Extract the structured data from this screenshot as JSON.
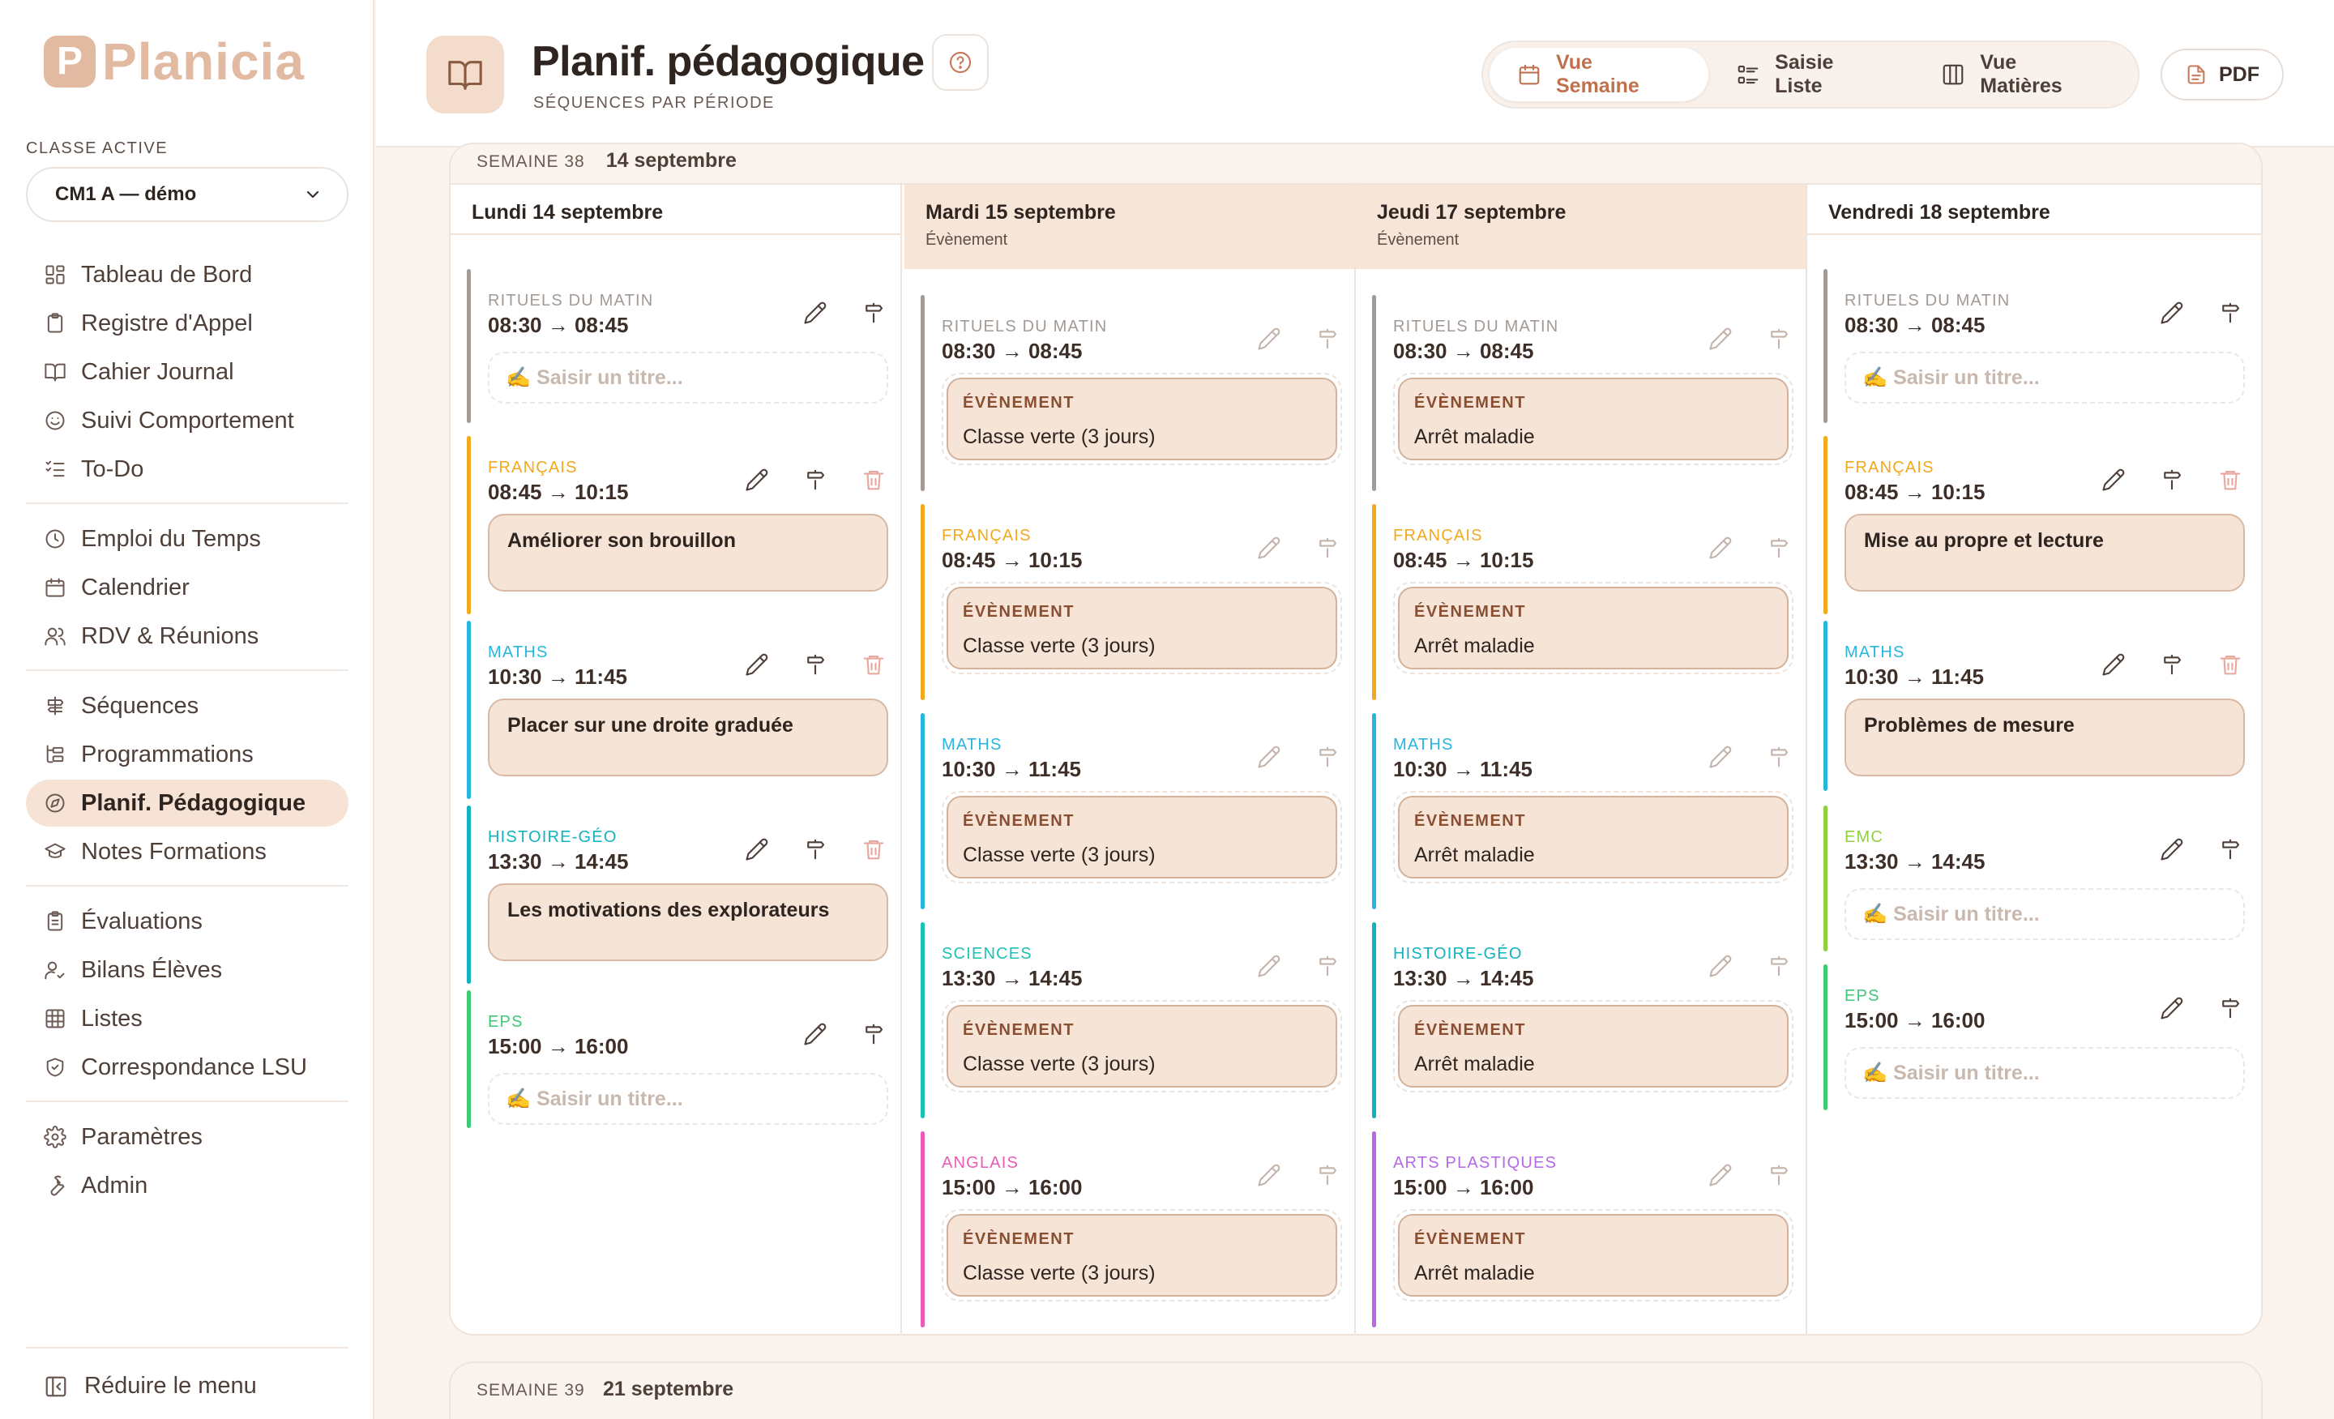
{
  "app": {
    "logo_letter": "P",
    "name": "Planicia"
  },
  "sidebar": {
    "class_caption": "CLASSE ACTIVE",
    "class_value": "CM1 A — démo",
    "groups": [
      [
        {
          "label": "Tableau de Bord",
          "icon": "dashboard-icon"
        },
        {
          "label": "Registre d'Appel",
          "icon": "clipboard-icon"
        },
        {
          "label": "Cahier Journal",
          "icon": "book-open-icon"
        },
        {
          "label": "Suivi Comportement",
          "icon": "smile-icon"
        },
        {
          "label": "To-Do",
          "icon": "checklist-icon"
        }
      ],
      [
        {
          "label": "Emploi du Temps",
          "icon": "clock-icon"
        },
        {
          "label": "Calendrier",
          "icon": "calendar-icon"
        },
        {
          "label": "RDV & Réunions",
          "icon": "users-icon"
        }
      ],
      [
        {
          "label": "Séquences",
          "icon": "signpost-icon"
        },
        {
          "label": "Programmations",
          "icon": "tree-icon"
        },
        {
          "label": "Planif. Pédagogique",
          "icon": "compass-icon",
          "active": true
        },
        {
          "label": "Notes Formations",
          "icon": "graduation-cap-icon"
        }
      ],
      [
        {
          "label": "Évaluations",
          "icon": "clipboard-check-icon"
        },
        {
          "label": "Bilans Élèves",
          "icon": "user-check-icon"
        },
        {
          "label": "Listes",
          "icon": "table-icon"
        },
        {
          "label": "Correspondance LSU",
          "icon": "shield-icon"
        }
      ],
      [
        {
          "label": "Paramètres",
          "icon": "gear-icon"
        },
        {
          "label": "Admin",
          "icon": "wrench-icon"
        }
      ]
    ],
    "collapse_label": "Réduire le menu"
  },
  "header": {
    "title": "Planif. pédagogique",
    "subtitle": "SÉQUENCES PAR PÉRIODE",
    "views": [
      {
        "label": "Vue Semaine",
        "icon": "calendar-icon",
        "active": true
      },
      {
        "label": "Saisie Liste",
        "icon": "list-icon"
      },
      {
        "label": "Vue Matières",
        "icon": "columns-icon"
      }
    ],
    "pdf_label": "PDF"
  },
  "week": {
    "number": "SEMAINE 38",
    "date": "14 septembre",
    "days": [
      {
        "title": "Lundi 14 septembre",
        "event_label": "",
        "slots": [
          {
            "subject": "RITUELS DU MATIN",
            "color": "#a39a95",
            "time": "08:30 → 08:45",
            "kind": "empty",
            "text": "✍️ Saisir un titre...",
            "delete": false
          },
          {
            "subject": "FRANÇAIS",
            "color": "#f2a91e",
            "time": "08:45 → 10:15",
            "kind": "title",
            "text": "Améliorer son brouillon",
            "delete": true
          },
          {
            "subject": "MATHS",
            "color": "#27b6de",
            "time": "10:30 → 11:45",
            "kind": "title",
            "text": "Placer sur une droite graduée",
            "delete": true
          },
          {
            "subject": "HISTOIRE-GÉO",
            "color": "#12b3bf",
            "time": "13:30 → 14:45",
            "kind": "title",
            "text": "Les motivations des explorateurs",
            "delete": true
          },
          {
            "subject": "EPS",
            "color": "#3ec975",
            "time": "15:00 → 16:00",
            "kind": "empty",
            "text": "✍️ Saisir un titre...",
            "delete": false
          }
        ]
      },
      {
        "title": "Mardi 15 septembre",
        "event_label": "Évènement",
        "slots": [
          {
            "subject": "RITUELS DU MATIN",
            "color": "#a39a95",
            "time": "08:30 → 08:45",
            "kind": "event",
            "tag": "ÉVÈNEMENT",
            "text": "Classe verte (3 jours)"
          },
          {
            "subject": "FRANÇAIS",
            "color": "#f2a91e",
            "time": "08:45 → 10:15",
            "kind": "event",
            "tag": "ÉVÈNEMENT",
            "text": "Classe verte (3 jours)"
          },
          {
            "subject": "MATHS",
            "color": "#27b6de",
            "time": "10:30 → 11:45",
            "kind": "event",
            "tag": "ÉVÈNEMENT",
            "text": "Classe verte (3 jours)"
          },
          {
            "subject": "SCIENCES",
            "color": "#1cc3b5",
            "time": "13:30 → 14:45",
            "kind": "event",
            "tag": "ÉVÈNEMENT",
            "text": "Classe verte (3 jours)"
          },
          {
            "subject": "ANGLAIS",
            "color": "#ea5bb7",
            "time": "15:00 → 16:00",
            "kind": "event",
            "tag": "ÉVÈNEMENT",
            "text": "Classe verte (3 jours)"
          }
        ]
      },
      {
        "title": "Jeudi 17 septembre",
        "event_label": "Évènement",
        "slots": [
          {
            "subject": "RITUELS DU MATIN",
            "color": "#a39a95",
            "time": "08:30 → 08:45",
            "kind": "event",
            "tag": "ÉVÈNEMENT",
            "text": "Arrêt maladie"
          },
          {
            "subject": "FRANÇAIS",
            "color": "#f2a91e",
            "time": "08:45 → 10:15",
            "kind": "event",
            "tag": "ÉVÈNEMENT",
            "text": "Arrêt maladie"
          },
          {
            "subject": "MATHS",
            "color": "#27b6de",
            "time": "10:30 → 11:45",
            "kind": "event",
            "tag": "ÉVÈNEMENT",
            "text": "Arrêt maladie"
          },
          {
            "subject": "HISTOIRE-GÉO",
            "color": "#12b3bf",
            "time": "13:30 → 14:45",
            "kind": "event",
            "tag": "ÉVÈNEMENT",
            "text": "Arrêt maladie"
          },
          {
            "subject": "ARTS PLASTIQUES",
            "color": "#b66ae8",
            "time": "15:00 → 16:00",
            "kind": "event",
            "tag": "ÉVÈNEMENT",
            "text": "Arrêt maladie"
          }
        ]
      },
      {
        "title": "Vendredi 18 septembre",
        "event_label": "",
        "slots": [
          {
            "subject": "RITUELS DU MATIN",
            "color": "#a39a95",
            "time": "08:30 → 08:45",
            "kind": "empty",
            "text": "✍️ Saisir un titre...",
            "delete": false
          },
          {
            "subject": "FRANÇAIS",
            "color": "#f2a91e",
            "time": "08:45 → 10:15",
            "kind": "title",
            "text": "Mise au propre et lecture",
            "delete": true
          },
          {
            "subject": "MATHS",
            "color": "#27b6de",
            "time": "10:30 → 11:45",
            "kind": "title",
            "text": "Problèmes de mesure",
            "delete": true
          },
          {
            "subject": "EMC",
            "color": "#8fd13c",
            "time": "13:30 → 14:45",
            "kind": "empty",
            "text": "✍️ Saisir un titre...",
            "delete": false
          },
          {
            "subject": "EPS",
            "color": "#3ec975",
            "time": "15:00 → 16:00",
            "kind": "empty",
            "text": "✍️ Saisir un titre...",
            "delete": false
          }
        ]
      }
    ]
  },
  "next_week": {
    "number": "SEMAINE 39",
    "date": "21 septembre"
  }
}
